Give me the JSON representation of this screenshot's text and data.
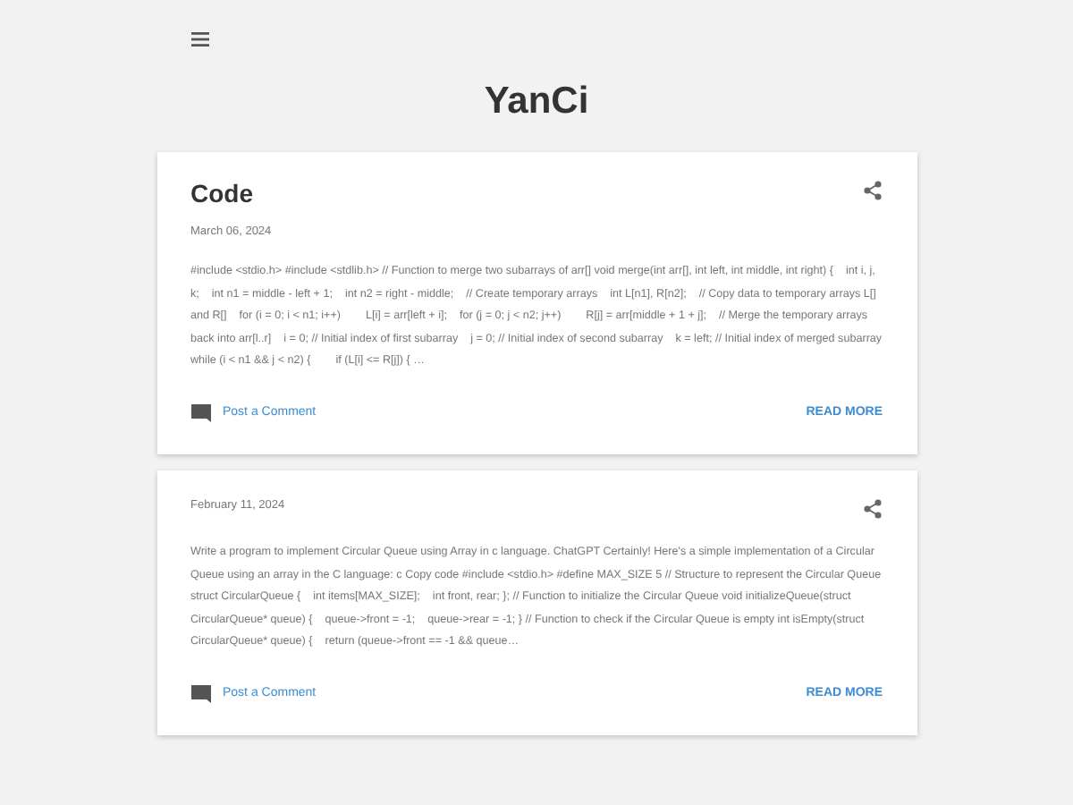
{
  "blog": {
    "title": "YanCi"
  },
  "posts": [
    {
      "title": "Code",
      "date": "March 06, 2024",
      "snippet": "#include <stdio.h> #include <stdlib.h> // Function to merge two subarrays of arr[] void merge(int arr[], int left, int middle, int right) {    int i, j, k;    int n1 = middle - left + 1;    int n2 = right - middle;    // Create temporary arrays    int L[n1], R[n2];    // Copy data to temporary arrays L[] and R[]    for (i = 0; i < n1; i++)        L[i] = arr[left + i];    for (j = 0; j < n2; j++)        R[j] = arr[middle + 1 + j];    // Merge the temporary arrays back into arr[l..r]    i = 0; // Initial index of first subarray    j = 0; // Initial index of second subarray    k = left; // Initial index of merged subarray    while (i < n1 && j < n2) {        if (L[i] <= R[j]) { …",
      "comment_link": "Post a Comment",
      "read_more": "READ MORE"
    },
    {
      "date": "February 11, 2024",
      "snippet": "Write a program to implement Circular Queue using Array in c language. ChatGPT Certainly! Here's a simple implementation of a Circular Queue using an array in the C language: c Copy code #include <stdio.h> #define MAX_SIZE 5 // Structure to represent the Circular Queue struct CircularQueue {    int items[MAX_SIZE];    int front, rear; }; // Function to initialize the Circular Queue void initializeQueue(struct CircularQueue* queue) {    queue->front = -1;    queue->rear = -1; } // Function to check if the Circular Queue is empty int isEmpty(struct CircularQueue* queue) {    return (queue->front == -1 && queue…",
      "comment_link": "Post a Comment",
      "read_more": "READ MORE"
    }
  ]
}
